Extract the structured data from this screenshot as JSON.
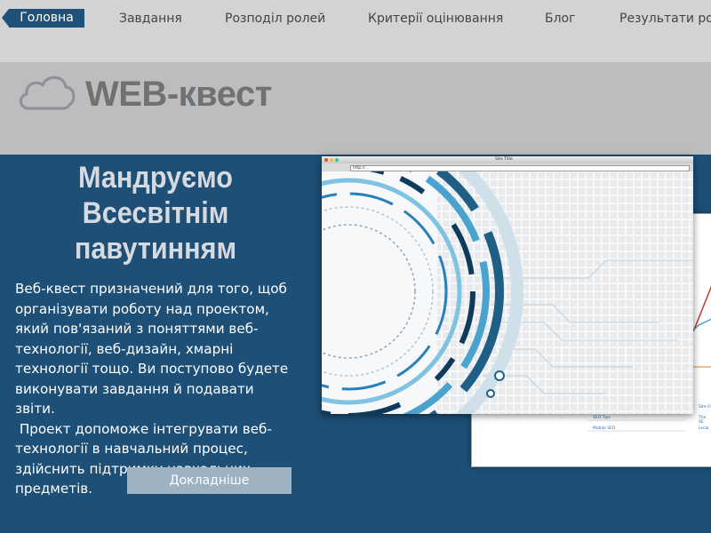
{
  "nav": {
    "items": [
      {
        "label": "Головна",
        "active": true
      },
      {
        "label": "Завдання",
        "active": false
      },
      {
        "label": "Розподіл ролей",
        "active": false
      },
      {
        "label": "Критерії оцінювання",
        "active": false
      },
      {
        "label": "Блог",
        "active": false
      },
      {
        "label": "Результати роботи",
        "active": false
      }
    ]
  },
  "header": {
    "logo_text": "WEB-квест",
    "icon": "cloud-icon"
  },
  "hero": {
    "headline_lines": [
      "Мандруємо",
      "Всесвітнім",
      "павутинням"
    ],
    "description_lines": [
      "Веб-квест призначений для того, щоб",
      "організувати роботу  над проектом,",
      "який пов'язаний з поняттями веб-",
      "технології, веб-дизайн, хмарні",
      "технології тощо.  Ви поступово  будете",
      "виконувати завдання й подавати звіти.",
      " Проект допоможе інтегрувати веб-",
      "технології в навчальний процес,",
      "здійснить підтримку навчальних",
      "предметів."
    ],
    "button_label": "Докладніше"
  },
  "illustration": {
    "browser_title": "Site Title",
    "browser_url": "http://...",
    "back_window_items": [
      "SEO Tips",
      "Mobile SEO"
    ],
    "back_window_right_items": [
      "Site O",
      "The SE",
      "Local"
    ]
  },
  "colors": {
    "accent": "#1e5278",
    "hero_bg": "#1d4f77",
    "nav_bg": "#d1d3d5",
    "band_bg": "#bbbdbf",
    "button_bg": "#9eb2c1"
  }
}
